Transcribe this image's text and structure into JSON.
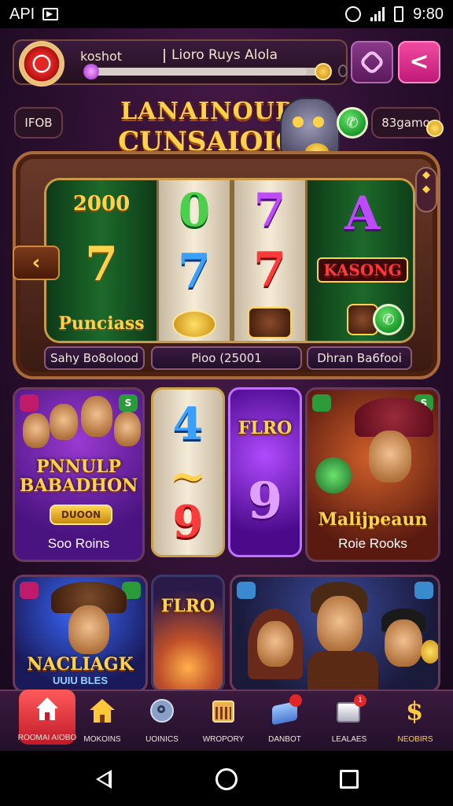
{
  "status_bar": {
    "left_text": "API",
    "time": "9:80"
  },
  "header": {
    "player_name": "koshot",
    "level_title": "Lioro Ruys Alola",
    "xp_progress": 0.92
  },
  "side_left": {
    "label": "IFOB"
  },
  "side_right": {
    "label": "83gamo"
  },
  "logo": {
    "line1": "LANAINOUD",
    "line2": "CUNSAIOIO"
  },
  "slot_machine": {
    "reels": [
      {
        "symbols": [
          "2000",
          "7",
          "Punciass"
        ]
      },
      {
        "symbols": [
          "0",
          "7",
          "coins"
        ]
      },
      {
        "symbols": [
          "7",
          "7",
          "chest"
        ]
      },
      {
        "symbols": [
          "A",
          "KASONG",
          "bag"
        ]
      }
    ],
    "label_left": "Sahy Bo8olood",
    "label_center": "Pioo (25001",
    "label_right": "Dhran Ba6fooi",
    "arrow": "‹",
    "side_icons": "◆\n◆"
  },
  "tiles": [
    {
      "title": "PNNULP\nBABADHON",
      "button": "DUOON",
      "subtitle": "Soo Roins",
      "badge": "S"
    },
    {
      "symbols": [
        "4",
        "~",
        "9"
      ]
    },
    {
      "title": "FLRO",
      "symbol": "9"
    },
    {
      "title": "Malijpeaun",
      "subtitle": "Roie Rooks",
      "badge": "S"
    },
    {
      "title": "NACLIAGK",
      "subtitle": "UUIU BLES"
    },
    {
      "title": "FLRO"
    },
    {
      "title": ""
    }
  ],
  "bottom_nav": [
    {
      "label": "ROOMAI AIOBO",
      "icon": "home-icon",
      "active": true
    },
    {
      "label": "MOKOINS",
      "icon": "house-icon"
    },
    {
      "label": "UOINICS",
      "icon": "key-icon"
    },
    {
      "label": "WROPORY",
      "icon": "calendar-icon"
    },
    {
      "label": "DANBOT",
      "icon": "card-icon",
      "badge": ""
    },
    {
      "label": "LEALAES",
      "icon": "box-icon",
      "badge": "1"
    },
    {
      "label": "NEOBIRS",
      "icon": "dollar-icon"
    }
  ],
  "colors": {
    "accent_gold": "#ffd24a",
    "active_nav": "#e32626",
    "background": "#2a0f2e"
  }
}
